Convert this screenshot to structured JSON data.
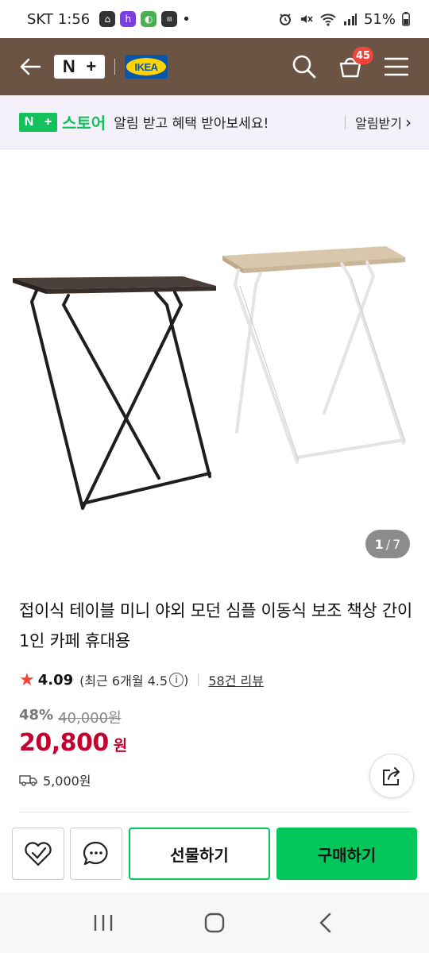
{
  "status_bar": {
    "carrier": "SKT",
    "time": "1:56",
    "dot": "•",
    "battery": "51%"
  },
  "nav": {
    "logo_left": "N",
    "logo_right": "+",
    "brand_logo": "IKEA",
    "cart_count": "45",
    "colors": {
      "bar": "#6b5444",
      "badge": "#f0453a"
    }
  },
  "notice": {
    "store_badge_n": "N",
    "store_badge_plus": "+",
    "store_name": "스토어",
    "message": "알림 받고 혜택 받아보세요!",
    "link": "알림받기",
    "chevron": "›"
  },
  "gallery": {
    "current": "1",
    "separator": "/",
    "total": "7"
  },
  "product": {
    "title": "접이식 테이블 미니 야외 모던 심플 이동식 보조 책상 간이 1인 카페 휴대용",
    "rating": "4.09",
    "recent_rating": "(최근 6개월 4.5",
    "recent_rating_close": ")",
    "reviews": "58건 리뷰",
    "discount": "48%",
    "original_price": "40,000원",
    "price": "20,800",
    "currency": "원",
    "shipping": "5,000원",
    "colors": {
      "price": "#c4002e",
      "star": "#f0453a"
    }
  },
  "actions": {
    "gift": "선물하기",
    "buy": "구매하기",
    "colors": {
      "green": "#03c75a"
    }
  },
  "icons": {
    "star": "★",
    "info": "i"
  }
}
